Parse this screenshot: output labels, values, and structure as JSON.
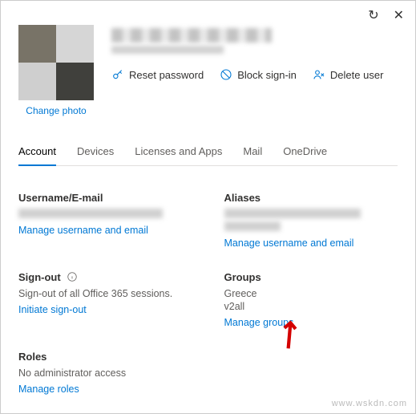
{
  "topbar": {
    "refresh": "↻",
    "close": "✕"
  },
  "header": {
    "change_photo": "Change photo",
    "actions": {
      "reset_password": "Reset password",
      "block_signin": "Block sign-in",
      "delete_user": "Delete user"
    }
  },
  "tabs": [
    "Account",
    "Devices",
    "Licenses and Apps",
    "Mail",
    "OneDrive"
  ],
  "active_tab": "Account",
  "sections": {
    "username": {
      "title": "Username/E-mail",
      "link": "Manage username and email"
    },
    "aliases": {
      "title": "Aliases",
      "link": "Manage username and email"
    },
    "signout": {
      "title": "Sign-out",
      "desc": "Sign-out of all Office 365 sessions.",
      "link": "Initiate sign-out"
    },
    "groups": {
      "title": "Groups",
      "items": [
        "Greece",
        "v2all"
      ],
      "link": "Manage groups"
    },
    "roles": {
      "title": "Roles",
      "desc": "No administrator access",
      "link": "Manage roles"
    }
  },
  "watermark": "www.wskdn.com"
}
